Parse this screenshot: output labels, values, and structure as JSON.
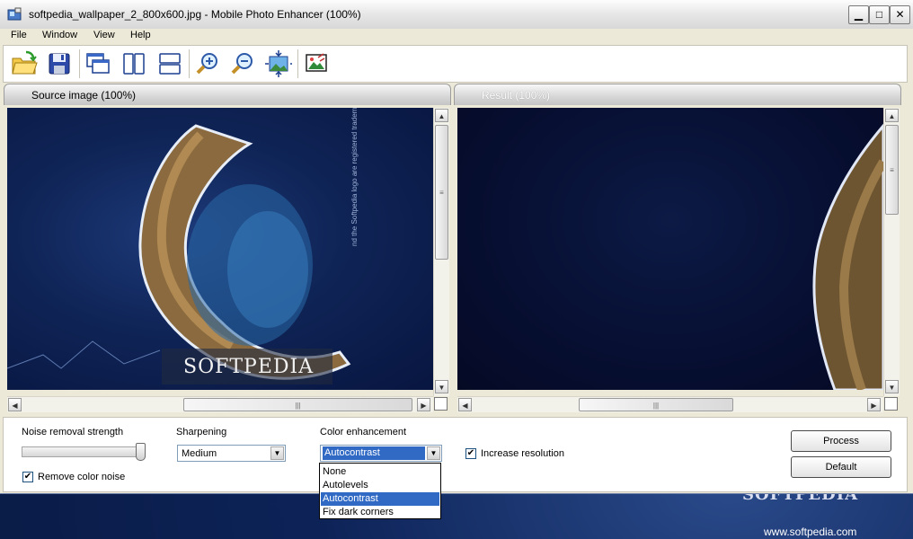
{
  "window": {
    "title": "softpedia_wallpaper_2_800x600.jpg - Mobile Photo Enhancer (100%)",
    "minimize": "▁",
    "maximize": "□",
    "close": "✕"
  },
  "menu": [
    {
      "label": "File"
    },
    {
      "label": "Window"
    },
    {
      "label": "View"
    },
    {
      "label": "Help"
    }
  ],
  "toolbar": {
    "icons": [
      "open-folder-icon",
      "save-icon",
      "cascade-windows-icon",
      "split-vertical-icon",
      "split-horizontal-icon",
      "zoom-in-icon",
      "zoom-out-icon",
      "fit-to-window-icon",
      "compare-icon"
    ]
  },
  "source_panel": {
    "title": "Source image (100%)",
    "logo_text": "SOFTPEDIA",
    "side_text": "nd the Softpedia logo are registered trademarks."
  },
  "result_panel": {
    "title": "Result (100%)"
  },
  "controls": {
    "noise_label": "Noise removal strength",
    "noise_level": 1.0,
    "remove_color_noise_label": "Remove color noise",
    "remove_color_noise_checked": true,
    "sharpening_label": "Sharpening",
    "sharpening_value": "Medium",
    "color_label": "Color enhancement",
    "color_value": "Autocontrast",
    "color_options": [
      "None",
      "Autolevels",
      "Autocontrast",
      "Fix dark corners"
    ],
    "increase_resolution_label": "Increase resolution",
    "increase_resolution_checked": true,
    "process_label": "Process",
    "default_label": "Default"
  },
  "desktop": {
    "logo": "SOFTPEDIA",
    "url": "www.softpedia.com"
  },
  "colors": {
    "selection": "#316ac5",
    "window_bg": "#ece9d8"
  }
}
